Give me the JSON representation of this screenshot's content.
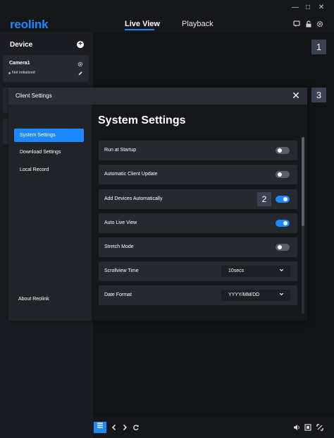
{
  "app": {
    "logo": "reolink",
    "tabs": [
      {
        "label": "Live View",
        "active": true
      },
      {
        "label": "Playback",
        "active": false
      }
    ],
    "window_controls": {
      "minimize": "—",
      "maximize": "□",
      "close": "✕"
    }
  },
  "header_icons": [
    "message-icon",
    "lock-icon",
    "gear-icon"
  ],
  "sidebar": {
    "title": "Device",
    "camera": {
      "name": "Camera1",
      "status": "Not initialized"
    }
  },
  "badges": {
    "one": "1",
    "two": "2",
    "three": "3"
  },
  "modal": {
    "title": "Client Settings",
    "close": "✕",
    "nav": [
      {
        "label": "System Settings",
        "active": true
      },
      {
        "label": "Download Settings",
        "active": false
      },
      {
        "label": "Local Record",
        "active": false
      }
    ],
    "about": "About Reolink",
    "content": {
      "title": "System Settings",
      "rows": [
        {
          "label": "Run at Startup",
          "control": "toggle",
          "on": false
        },
        {
          "label": "Automatic Client Update",
          "control": "toggle",
          "on": false
        },
        {
          "label": "Add Devices Automatically",
          "control": "toggle",
          "on": true
        },
        {
          "label": "Auto Live View",
          "control": "toggle",
          "on": true
        },
        {
          "label": "Stretch Mode",
          "control": "toggle",
          "on": false
        },
        {
          "label": "Scrollview Time",
          "control": "select",
          "value": "10secs"
        },
        {
          "label": "Date Format",
          "control": "select",
          "value": "YYYY/MM/DD"
        }
      ]
    }
  },
  "colors": {
    "accent": "#1e88ff",
    "background": "#0f1114",
    "panel": "#262930"
  }
}
